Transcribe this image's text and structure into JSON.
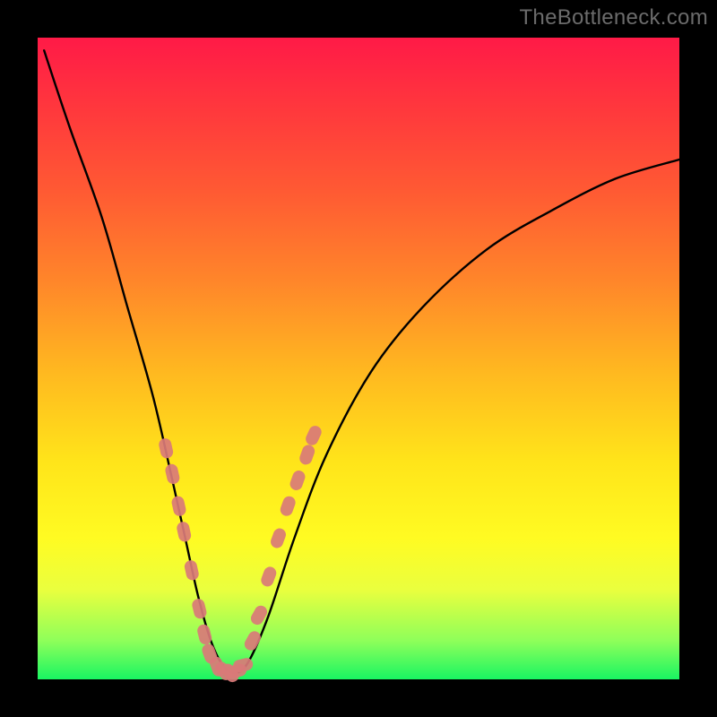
{
  "watermark": "TheBottleneck.com",
  "chart_data": {
    "type": "line",
    "title": "",
    "xlabel": "",
    "ylabel": "",
    "xlim": [
      0,
      100
    ],
    "ylim": [
      0,
      100
    ],
    "grid": false,
    "legend_position": "none",
    "series": [
      {
        "name": "bottleneck-curve",
        "x": [
          1,
          5,
          10,
          14,
          18,
          21,
          23,
          25,
          27,
          29,
          31,
          33,
          36,
          40,
          45,
          52,
          60,
          70,
          80,
          90,
          100
        ],
        "values": [
          98,
          86,
          72,
          58,
          44,
          31,
          22,
          13,
          6,
          2,
          1,
          3,
          10,
          22,
          35,
          48,
          58,
          67,
          73,
          78,
          81
        ],
        "color": "#000000"
      }
    ],
    "markers": [
      {
        "name": "left-dense-group",
        "x": [
          20.0,
          21.0,
          22.0,
          22.8,
          24.0,
          25.2,
          26.0,
          26.8
        ],
        "y": [
          36,
          32,
          27,
          23,
          17,
          11,
          7,
          4
        ],
        "color": "#d97a78",
        "size": 14
      },
      {
        "name": "valley-group",
        "x": [
          28.0,
          29.0,
          30.0,
          31.0,
          32.0
        ],
        "y": [
          2,
          1.3,
          1,
          1.3,
          2.2
        ],
        "color": "#d97a78",
        "size": 14
      },
      {
        "name": "right-dense-group",
        "x": [
          33.5,
          34.5,
          36.0,
          37.5,
          39.0,
          40.5,
          42.0,
          43.0
        ],
        "y": [
          6,
          10,
          16,
          22,
          27,
          31,
          35,
          38
        ],
        "color": "#d97a78",
        "size": 14
      }
    ],
    "background_gradient": {
      "type": "vertical",
      "stops": [
        {
          "pos": 0.0,
          "color": "#ff1a47"
        },
        {
          "pos": 0.38,
          "color": "#ff862a"
        },
        {
          "pos": 0.66,
          "color": "#ffe41a"
        },
        {
          "pos": 0.86,
          "color": "#eaff3e"
        },
        {
          "pos": 1.0,
          "color": "#19f562"
        }
      ]
    }
  }
}
